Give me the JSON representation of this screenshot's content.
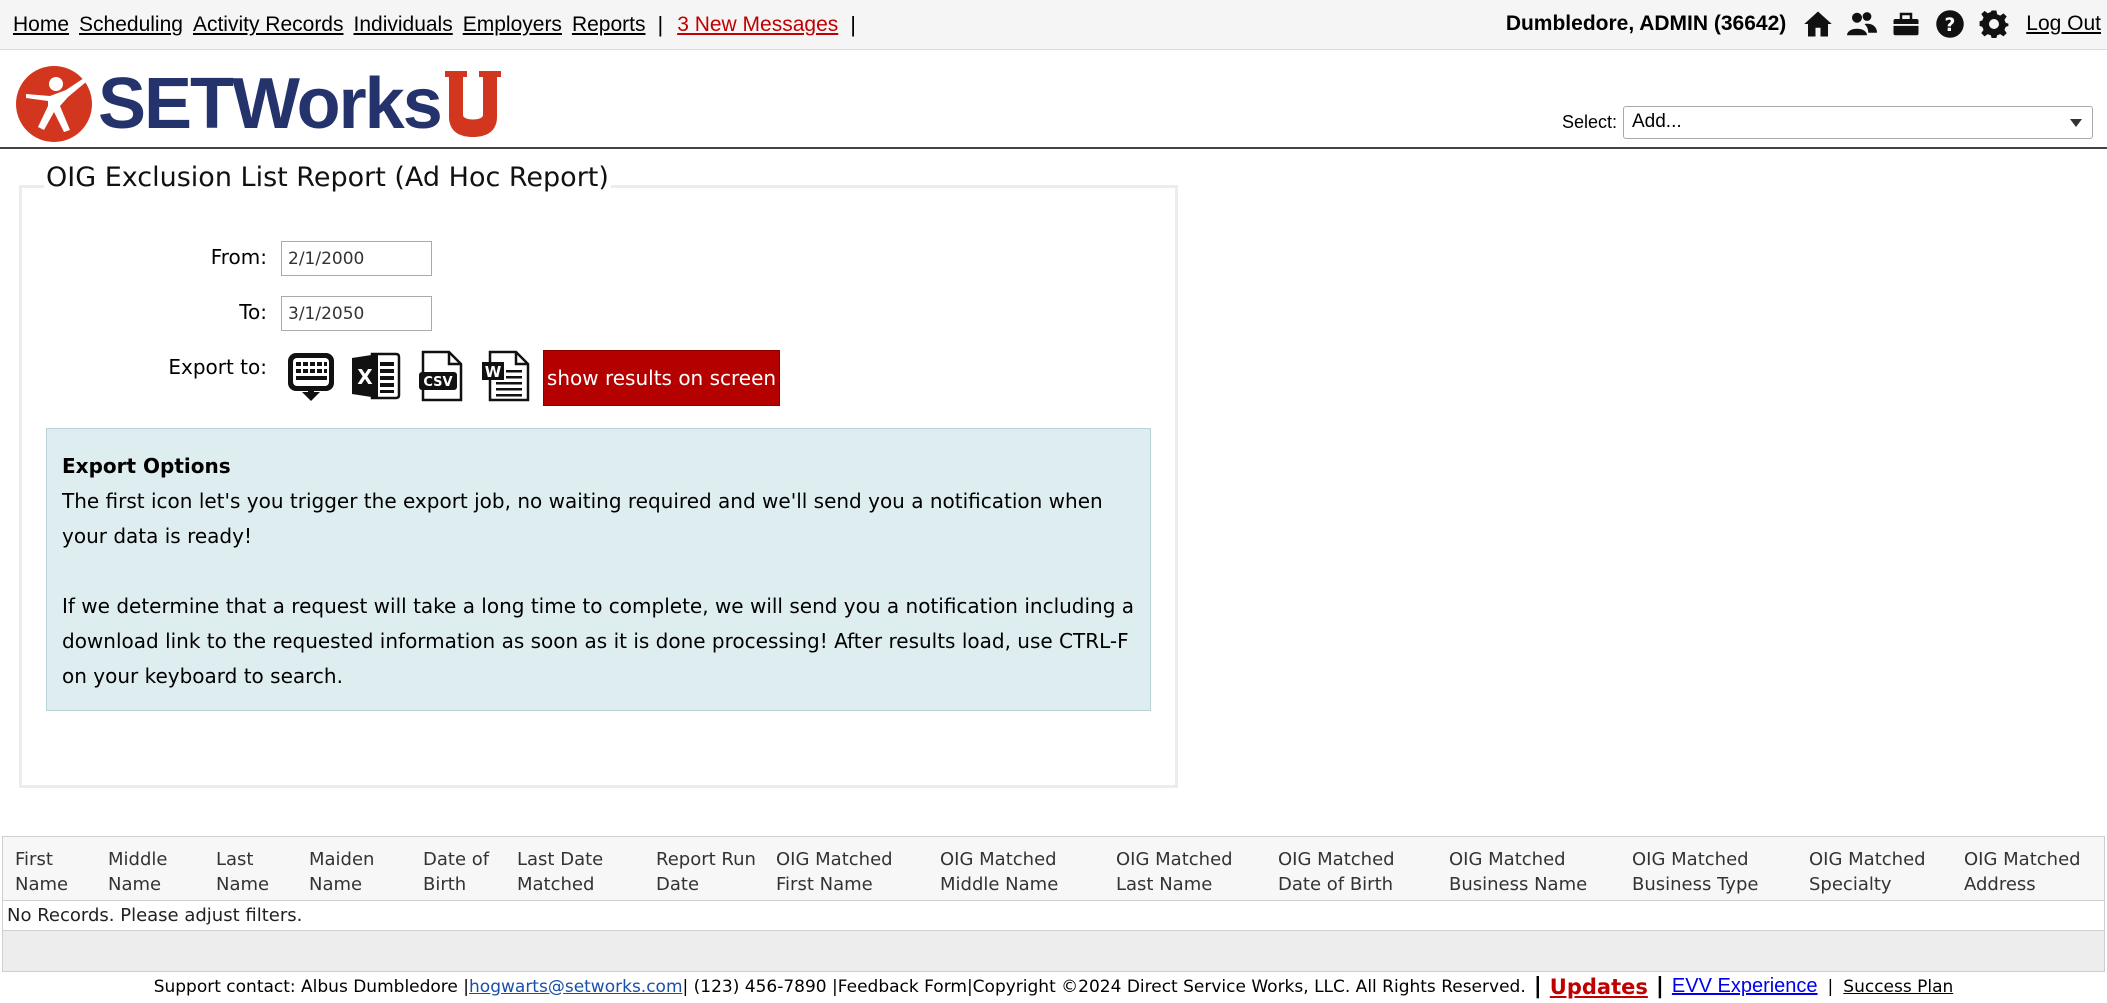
{
  "nav": {
    "links": [
      "Home",
      "Scheduling",
      "Activity Records",
      "Individuals",
      "Employers",
      "Reports"
    ],
    "messages": "3 New Messages",
    "user": "Dumbledore, ADMIN  (36642)",
    "logout": "Log Out",
    "icons": [
      "home-icon",
      "users-icon",
      "briefcase-icon",
      "help-icon",
      "gear-icon"
    ]
  },
  "header": {
    "logo_text": "SETWorks",
    "select_label": "Select:",
    "select_value": "Add..."
  },
  "report": {
    "title": "OIG Exclusion List Report (Ad Hoc Report)",
    "from_label": "From:",
    "from_value": "2/1/2000",
    "to_label": "To:",
    "to_value": "3/1/2050",
    "export_label": "Export to:",
    "export_icons": [
      "export-job-icon",
      "excel-icon",
      "csv-icon",
      "word-icon"
    ],
    "show_button": "show results on screen",
    "info_title": "Export Options",
    "info_p1": "The first icon let's you trigger the export job, no waiting required and we'll send you a notification when your data is ready!",
    "info_p2": "If we determine that a request will take a long time to complete, we will send you a notification including a download link to the requested information as soon as it is done processing! After results load, use CTRL-F on your keyboard to search."
  },
  "table": {
    "columns": [
      [
        "First",
        "Name"
      ],
      [
        "Middle",
        "Name"
      ],
      [
        "Last",
        "Name"
      ],
      [
        "Maiden",
        "Name"
      ],
      [
        "Date of",
        "Birth"
      ],
      [
        "Last Date",
        "Matched"
      ],
      [
        "Report Run",
        "Date"
      ],
      [
        "OIG Matched",
        "First Name"
      ],
      [
        "OIG Matched",
        "Middle Name"
      ],
      [
        "OIG Matched",
        "Last Name"
      ],
      [
        "OIG Matched",
        "Date of Birth"
      ],
      [
        "OIG Matched",
        "Business Name"
      ],
      [
        "OIG Matched",
        "Business Type"
      ],
      [
        "OIG Matched",
        "Specialty"
      ],
      [
        "OIG Matched",
        "Address"
      ]
    ],
    "empty_message": "No Records. Please adjust filters."
  },
  "footer": {
    "support": "Support contact: Albus Dumbledore | ",
    "email": "hogwarts@setworks.com",
    "phone": " | (123) 456-7890 |",
    "feedback": "Feedback Form",
    "copyright": "|Copyright ©2024 Direct Service Works, LLC. All Rights Reserved.",
    "updates": "Updates",
    "evv": "EVV Experience",
    "success": "Success Plan"
  },
  "colors": {
    "brand_navy": "#24336b",
    "brand_red": "#d3361f",
    "button_red": "#b50000",
    "info_bg": "#deedf0"
  }
}
